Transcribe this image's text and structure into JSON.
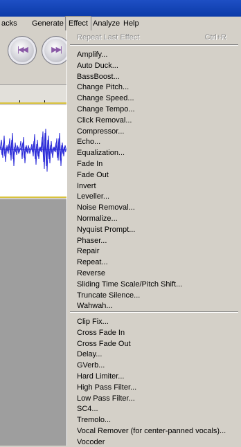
{
  "menubar": {
    "items": [
      "acks",
      "Generate",
      "Effect",
      "Analyze",
      "Help"
    ],
    "active": "Effect"
  },
  "toolbar": {
    "skip_start_icon": "skip-to-start-icon",
    "skip_end_icon": "skip-to-end-icon",
    "button_color": "#8a5aa6"
  },
  "track": {
    "waveform_color": "#2a2ad8",
    "border_color": "#d8c23c"
  },
  "effect_menu": {
    "repeat_last": {
      "label": "Repeat Last Effect",
      "shortcut": "Ctrl+R",
      "enabled": false
    },
    "group1": [
      "Amplify...",
      "Auto Duck...",
      "BassBoost...",
      "Change Pitch...",
      "Change Speed...",
      "Change Tempo...",
      "Click Removal...",
      "Compressor...",
      "Echo...",
      "Equalization...",
      "Fade In",
      "Fade Out",
      "Invert",
      "Leveller...",
      "Noise Removal...",
      "Normalize...",
      "Nyquist Prompt...",
      "Phaser...",
      "Repair",
      "Repeat...",
      "Reverse",
      "Sliding Time Scale/Pitch Shift...",
      "Truncate Silence...",
      "Wahwah..."
    ],
    "group2": [
      "Clip Fix...",
      "Cross Fade In",
      "Cross Fade Out",
      "Delay...",
      "GVerb...",
      "Hard Limiter...",
      "High Pass Filter...",
      "Low Pass Filter...",
      "SC4...",
      "Tremolo...",
      "Vocal Remover (for center-panned vocals)...",
      "Vocoder"
    ]
  }
}
